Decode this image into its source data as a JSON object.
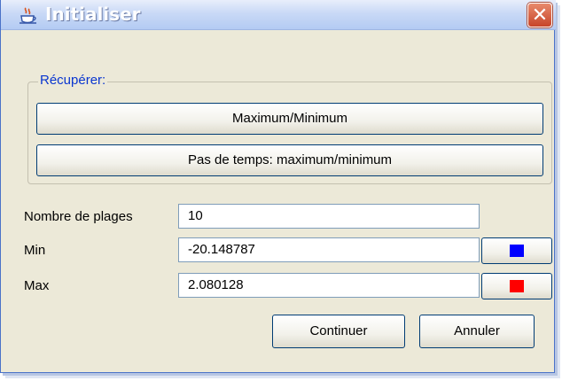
{
  "window": {
    "title": "Initialiser",
    "close_glyph": "✕"
  },
  "group": {
    "legend": "Récupérer:",
    "buttons": [
      {
        "label": "Maximum/Minimum"
      },
      {
        "label": "Pas de temps: maximum/minimum"
      }
    ]
  },
  "form": {
    "ranges_label": "Nombre de plages",
    "ranges_value": "10",
    "min_label": "Min",
    "min_value": "-20.148787",
    "min_color": "#0000ff",
    "max_label": "Max",
    "max_value": "2.080128",
    "max_color": "#ff0000"
  },
  "actions": {
    "continue_label": "Continuer",
    "cancel_label": "Annuler"
  },
  "icons": {
    "app_icon": "java-coffee-cup-icon",
    "close_icon": "close-icon"
  }
}
